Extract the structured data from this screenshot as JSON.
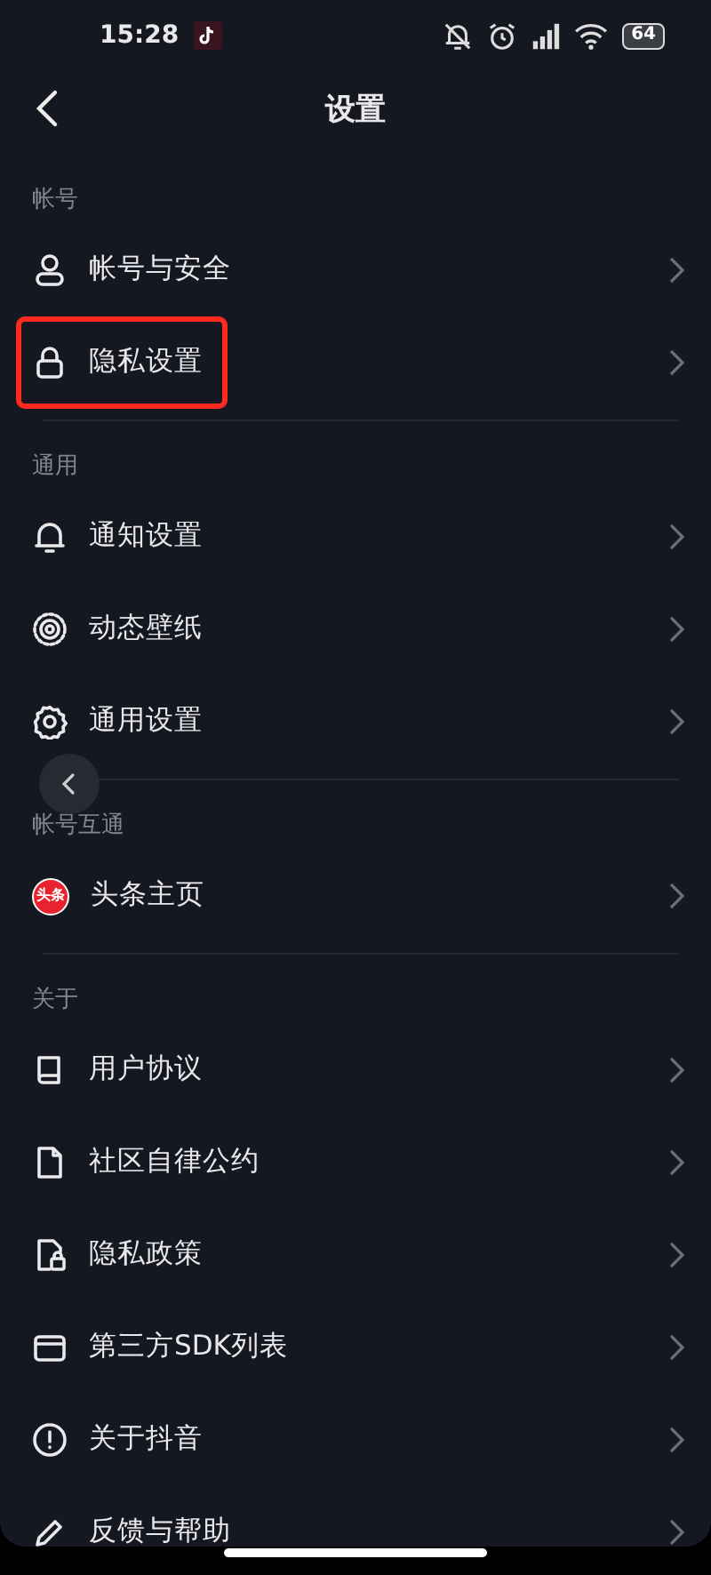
{
  "status_bar": {
    "time": "15:28",
    "battery": "64"
  },
  "header": {
    "title": "设置"
  },
  "sections": [
    {
      "label": "帐号",
      "items": [
        {
          "label": "帐号与安全",
          "highlighted": false
        },
        {
          "label": "隐私设置",
          "highlighted": true
        }
      ]
    },
    {
      "label": "通用",
      "items": [
        {
          "label": "通知设置",
          "highlighted": false
        },
        {
          "label": "动态壁纸",
          "highlighted": false
        },
        {
          "label": "通用设置",
          "highlighted": false
        }
      ]
    },
    {
      "label": "帐号互通",
      "items": [
        {
          "label": "头条主页",
          "highlighted": false,
          "logo_text": "头条"
        }
      ]
    },
    {
      "label": "关于",
      "items": [
        {
          "label": "用户协议",
          "highlighted": false
        },
        {
          "label": "社区自律公约",
          "highlighted": false
        },
        {
          "label": "隐私政策",
          "highlighted": false
        },
        {
          "label": "第三方SDK列表",
          "highlighted": false
        },
        {
          "label": "关于抖音",
          "highlighted": false
        },
        {
          "label": "反馈与帮助",
          "highlighted": false
        }
      ]
    }
  ]
}
